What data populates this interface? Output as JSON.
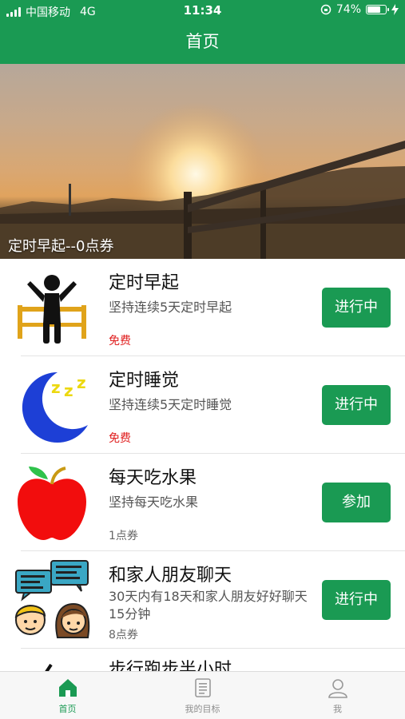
{
  "status_bar": {
    "carrier": "中国移动",
    "network": "4G",
    "time": "11:34",
    "battery": "74%",
    "battery_level": 0.74
  },
  "nav": {
    "title": "首页"
  },
  "banner": {
    "caption": "定时早起--0点券"
  },
  "items": [
    {
      "title": "定时早起",
      "desc": "坚持连续5天定时早起",
      "price": "免费",
      "price_free": true,
      "button": "进行中",
      "icon": "person-stretching-bed-icon"
    },
    {
      "title": "定时睡觉",
      "desc": "坚持连续5天定时睡觉",
      "price": "免费",
      "price_free": true,
      "button": "进行中",
      "icon": "moon-zzz-icon"
    },
    {
      "title": "每天吃水果",
      "desc": "坚持每天吃水果",
      "price": "1点券",
      "price_free": false,
      "button": "参加",
      "icon": "apple-icon"
    },
    {
      "title": "和家人朋友聊天",
      "desc": "30天内有18天和家人朋友好好聊天15分钟",
      "price": "8点券",
      "price_free": false,
      "button": "进行中",
      "icon": "chat-people-icon"
    },
    {
      "title": "步行跑步半小时",
      "icon": "running-icon"
    }
  ],
  "tabs": [
    {
      "label": "首页",
      "icon": "home-icon",
      "active": true
    },
    {
      "label": "我的目标",
      "icon": "checklist-icon",
      "active": false
    },
    {
      "label": "我",
      "icon": "user-icon",
      "active": false
    }
  ],
  "colors": {
    "primary": "#1a9a53",
    "free_price": "#e02020"
  }
}
